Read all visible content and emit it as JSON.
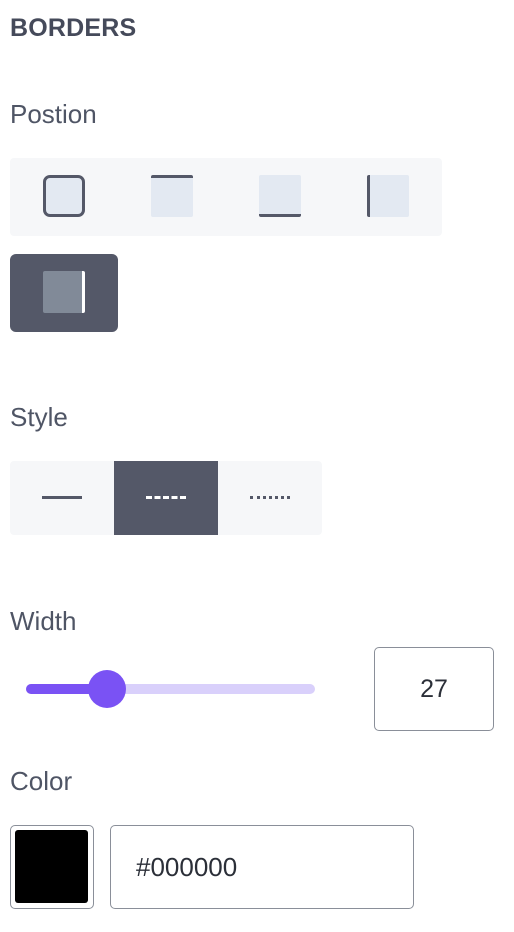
{
  "panel": {
    "title": "BORDERS"
  },
  "position": {
    "label": "Postion",
    "options": [
      "all",
      "top",
      "bottom",
      "left",
      "right"
    ],
    "selected": "right"
  },
  "style": {
    "label": "Style",
    "options": [
      "solid",
      "dashed",
      "dotted"
    ],
    "selected": "dashed"
  },
  "width": {
    "label": "Width",
    "value": "27",
    "slider_fraction": 0.28
  },
  "color": {
    "label": "Color",
    "value": "#000000",
    "swatch_hex": "#000000"
  },
  "theme": {
    "accent": "#7a52f4",
    "accent_light": "#d9d0fb",
    "selected_bg": "#545868"
  }
}
